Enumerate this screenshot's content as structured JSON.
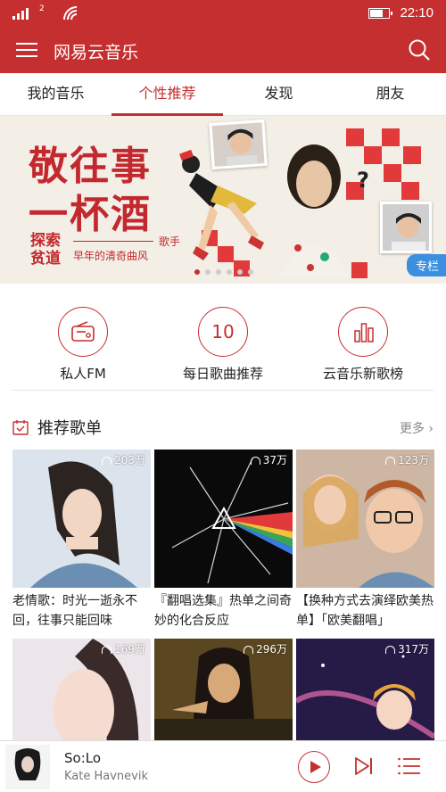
{
  "status_bar": {
    "indicator_2": "2",
    "time": "22:10",
    "battery_level": 0.8
  },
  "app_bar": {
    "title": "网易云音乐"
  },
  "tabs": [
    {
      "label": "我的音乐",
      "active": false
    },
    {
      "label": "个性推荐",
      "active": true
    },
    {
      "label": "发现",
      "active": false
    },
    {
      "label": "朋友",
      "active": false
    }
  ],
  "banner": {
    "line1": "敬往事",
    "line2": "一杯酒",
    "tag": "探索贫道",
    "sub1": "歌手",
    "sub2": "早年的清奇曲风",
    "badge": "专栏"
  },
  "quick": [
    {
      "label": "私人FM",
      "icon": "radio-icon"
    },
    {
      "label": "每日歌曲推荐",
      "icon": "calendar-icon",
      "value": "10"
    },
    {
      "label": "云音乐新歌榜",
      "icon": "chart-icon"
    }
  ],
  "section": {
    "title": "推荐歌单",
    "more": "更多"
  },
  "playlists": [
    {
      "title": "老情歌：时光一逝永不回，往事只能回味",
      "count": "203万",
      "bg": "#dce4ec"
    },
    {
      "title": "『翻唱选集』热单之间奇妙的化合反应",
      "count": "37万",
      "bg": "#111"
    },
    {
      "title": "【换种方式去演绎欧美热单】「欧美翻唱」",
      "count": "123万",
      "bg": "#d9c8b8"
    },
    {
      "title": "",
      "count": "169万",
      "bg": "#e8e0e4"
    },
    {
      "title": "",
      "count": "296万",
      "bg": "#4a3a1a"
    },
    {
      "title": "",
      "count": "317万",
      "bg": "#2a1a4a"
    }
  ],
  "player": {
    "song": "So:Lo",
    "artist": "Kate Havnevik"
  },
  "colors": {
    "brand": "#c62f2f",
    "accent_blue": "#3b8fe0"
  }
}
